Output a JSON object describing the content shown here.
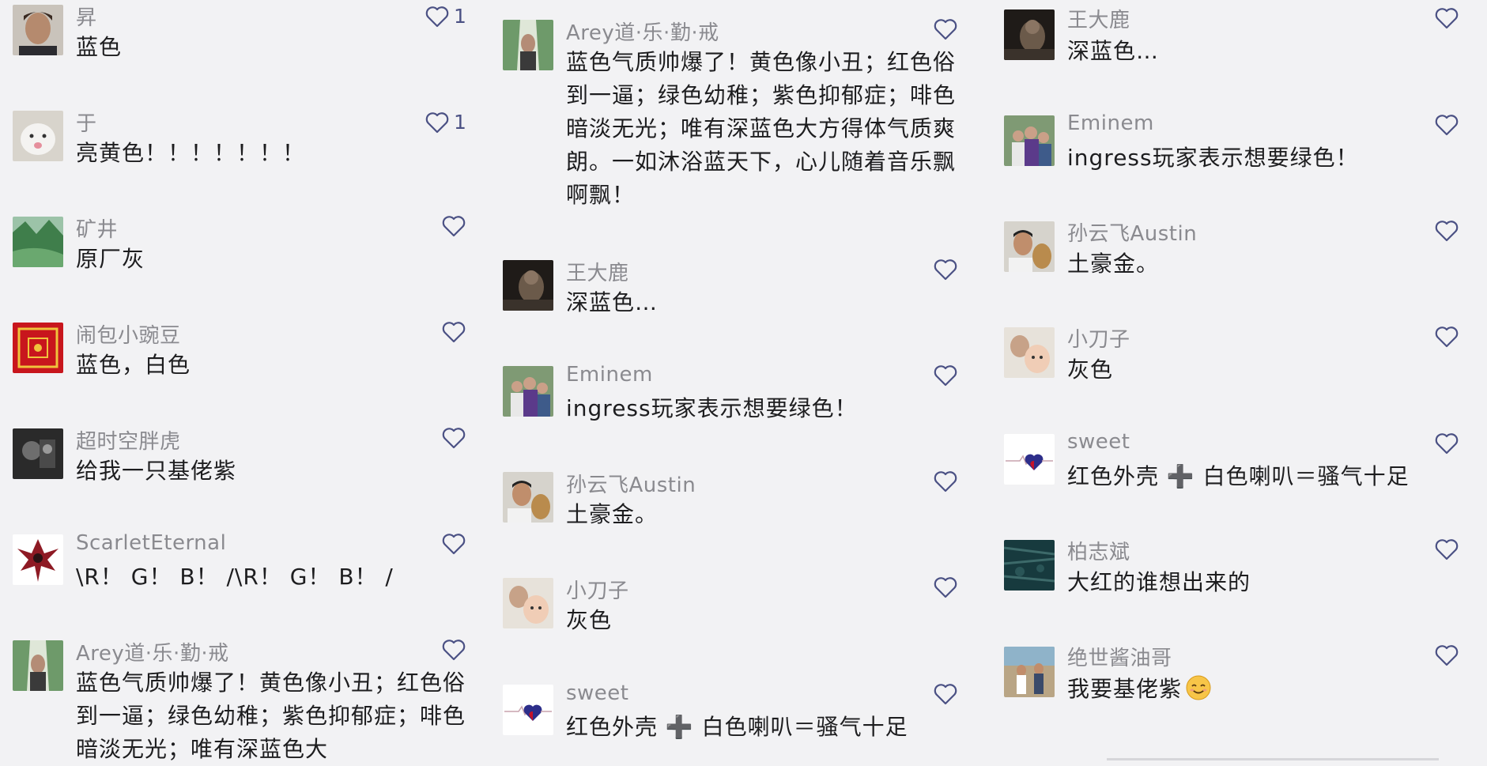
{
  "columns": [
    {
      "comments": [
        {
          "username": "昇",
          "text": "蓝色",
          "likes": "1",
          "avatar": "man-portrait"
        },
        {
          "username": "于",
          "text": "亮黄色！！！！！！！",
          "likes": "1",
          "avatar": "white-cat"
        },
        {
          "username": "矿井",
          "text": "原厂灰",
          "likes": "",
          "avatar": "green-landscape"
        },
        {
          "username": "闹包小豌豆",
          "text": "蓝色，白色",
          "likes": "",
          "avatar": "red-pattern"
        },
        {
          "username": "超时空胖虎",
          "text": "给我一只基佬紫",
          "likes": "",
          "avatar": "dark-photo"
        },
        {
          "username": "ScarletEternal",
          "text": "\\R！ G！ B！ /\\R！ G！ B！ /",
          "likes": "",
          "avatar": "red-emblem"
        },
        {
          "username": "Arey道·乐·勤·戒",
          "text": "蓝色气质帅爆了！黄色像小丑；红色俗到一逼；绿色幼稚；紫色抑郁症；啡色暗淡无光；唯有深蓝色大",
          "likes": "",
          "avatar": "green-painting"
        }
      ]
    },
    {
      "comments": [
        {
          "username": "Arey道·乐·勤·戒",
          "text": "蓝色气质帅爆了！黄色像小丑；红色俗到一逼；绿色幼稚；紫色抑郁症；啡色暗淡无光；唯有深蓝色大方得体气质爽朗。一如沐浴蓝天下，心儿随着音乐飘啊飘！",
          "likes": "",
          "avatar": "green-painting"
        },
        {
          "username": "王大鹿",
          "text": "深蓝色…",
          "likes": "",
          "avatar": "dark-cat"
        },
        {
          "username": "Eminem",
          "text": "ingress玩家表示想要绿色！",
          "likes": "",
          "avatar": "group-photo"
        },
        {
          "username": "孙云飞Austin",
          "text": "土豪金。",
          "likes": "",
          "avatar": "man-with-toy"
        },
        {
          "username": "小刀子",
          "text": "灰色",
          "likes": "",
          "avatar": "baby-photo"
        },
        {
          "username": "sweet",
          "text": "红色外壳 ➕ 白色喇叭＝骚气十足",
          "likes": "",
          "avatar": "heart-line"
        }
      ]
    },
    {
      "comments": [
        {
          "username": "王大鹿",
          "text": "深蓝色…",
          "likes": "",
          "avatar": "dark-cat"
        },
        {
          "username": "Eminem",
          "text": "ingress玩家表示想要绿色！",
          "likes": "",
          "avatar": "group-photo"
        },
        {
          "username": "孙云飞Austin",
          "text": "土豪金。",
          "likes": "",
          "avatar": "man-with-toy"
        },
        {
          "username": "小刀子",
          "text": "灰色",
          "likes": "",
          "avatar": "baby-photo"
        },
        {
          "username": "sweet",
          "text": "红色外壳 ➕ 白色喇叭＝骚气十足",
          "likes": "",
          "avatar": "heart-line"
        },
        {
          "username": "柏志斌",
          "text": "大红的谁想出来的",
          "likes": "",
          "avatar": "dark-teal"
        },
        {
          "username": "绝世酱油哥",
          "text": "我要基佬紫",
          "likes": "",
          "avatar": "street-photo",
          "emoji": "smiling-face-emoji"
        }
      ]
    }
  ],
  "colors": {
    "background": "#f2f2f4",
    "username": "#8a8a8f",
    "text": "#1d1d1f",
    "like_icon": "#4b5184"
  }
}
